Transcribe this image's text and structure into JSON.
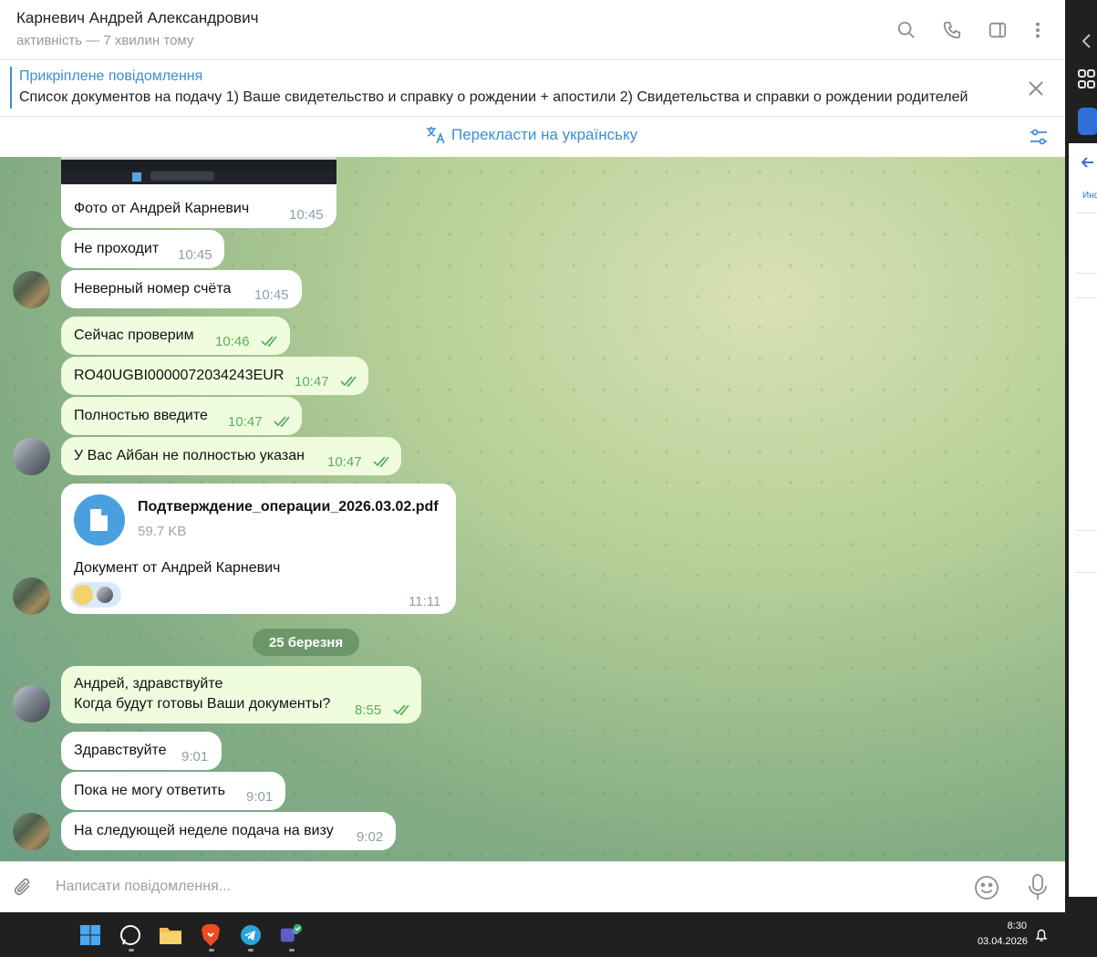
{
  "header": {
    "name": "Карневич Андрей Александрович",
    "status": "активність — 7 хвилин тому"
  },
  "pinned": {
    "title": "Прикріплене повідомлення",
    "text": "Список документов на подачу  1) Ваше свидетельство и справку о рождении + апостили 2) Свидетельства и справки о рождении родителей"
  },
  "translate": {
    "label": "Перекласти на українську"
  },
  "image_caption": {
    "text": "Фото от Андрей Карневич",
    "time": "10:45"
  },
  "messages": [
    {
      "text": "Не проходит",
      "time": "10:45"
    },
    {
      "text": "Неверный номер счёта",
      "time": "10:45"
    },
    {
      "text": "Сейчас проверим",
      "time": "10:46"
    },
    {
      "text": "RO40UGBI0000072034243EUR",
      "time": "10:47"
    },
    {
      "text": "Полностью введите",
      "time": "10:47"
    },
    {
      "text": "У Вас Айбан не полностью указан",
      "time": "10:47"
    }
  ],
  "file_message": {
    "name": "Подтверждение_операции_2026.03.02.pdf",
    "size": "59.7 KB",
    "caption": "Документ от Андрей Карневич",
    "time": "11:11"
  },
  "date_divider": "25 березня",
  "messages2": [
    {
      "line1": "Андрей, здравствуйте",
      "line2": "Когда будут готовы Ваши документы?",
      "time": "8:55"
    },
    {
      "text": "Здравствуйте",
      "time": "9:01"
    },
    {
      "text": "Пока не могу ответить",
      "time": "9:01"
    },
    {
      "text": "На следующей неделе подача на визу",
      "time": "9:02"
    }
  ],
  "composer": {
    "placeholder": "Написати повідомлення..."
  },
  "side_panel": {
    "label": "Инф"
  },
  "taskbar": {
    "time": "8:30",
    "date": "03.04.2026"
  },
  "colors": {
    "accent": "#3a8fd6",
    "outgoing_bubble": "#effdde",
    "check": "#5eab5e"
  }
}
